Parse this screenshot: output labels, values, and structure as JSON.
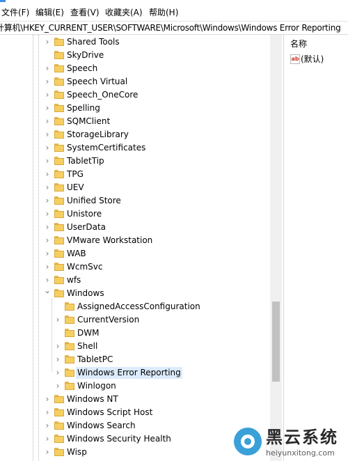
{
  "menubar": {
    "items": [
      "文件(F)",
      "编辑(E)",
      "查看(V)",
      "收藏夹(A)",
      "帮助(H)"
    ]
  },
  "address": {
    "path": "计算机\\HKEY_CURRENT_USER\\SOFTWARE\\Microsoft\\Windows\\Windows Error Reporting"
  },
  "tree": {
    "items": [
      {
        "label": "Shared Tools",
        "level": 1,
        "expander": "collapsed"
      },
      {
        "label": "SkyDrive",
        "level": 1,
        "expander": "none"
      },
      {
        "label": "Speech",
        "level": 1,
        "expander": "collapsed"
      },
      {
        "label": "Speech Virtual",
        "level": 1,
        "expander": "collapsed"
      },
      {
        "label": "Speech_OneCore",
        "level": 1,
        "expander": "collapsed"
      },
      {
        "label": "Spelling",
        "level": 1,
        "expander": "collapsed"
      },
      {
        "label": "SQMClient",
        "level": 1,
        "expander": "collapsed"
      },
      {
        "label": "StorageLibrary",
        "level": 1,
        "expander": "collapsed"
      },
      {
        "label": "SystemCertificates",
        "level": 1,
        "expander": "collapsed"
      },
      {
        "label": "TabletTip",
        "level": 1,
        "expander": "collapsed"
      },
      {
        "label": "TPG",
        "level": 1,
        "expander": "collapsed"
      },
      {
        "label": "UEV",
        "level": 1,
        "expander": "collapsed"
      },
      {
        "label": "Unified Store",
        "level": 1,
        "expander": "collapsed"
      },
      {
        "label": "Unistore",
        "level": 1,
        "expander": "collapsed"
      },
      {
        "label": "UserData",
        "level": 1,
        "expander": "collapsed"
      },
      {
        "label": "VMware Workstation",
        "level": 1,
        "expander": "collapsed"
      },
      {
        "label": "WAB",
        "level": 1,
        "expander": "collapsed"
      },
      {
        "label": "WcmSvc",
        "level": 1,
        "expander": "collapsed"
      },
      {
        "label": "wfs",
        "level": 1,
        "expander": "collapsed"
      },
      {
        "label": "Windows",
        "level": 1,
        "expander": "expanded"
      },
      {
        "label": "AssignedAccessConfiguration",
        "level": 2,
        "expander": "none"
      },
      {
        "label": "CurrentVersion",
        "level": 2,
        "expander": "collapsed"
      },
      {
        "label": "DWM",
        "level": 2,
        "expander": "none"
      },
      {
        "label": "Shell",
        "level": 2,
        "expander": "collapsed"
      },
      {
        "label": "TabletPC",
        "level": 2,
        "expander": "collapsed"
      },
      {
        "label": "Windows Error Reporting",
        "level": 2,
        "expander": "collapsed",
        "selected": true
      },
      {
        "label": "Winlogon",
        "level": 2,
        "expander": "collapsed"
      },
      {
        "label": "Windows NT",
        "level": 1,
        "expander": "collapsed"
      },
      {
        "label": "Windows Script Host",
        "level": 1,
        "expander": "collapsed"
      },
      {
        "label": "Windows Search",
        "level": 1,
        "expander": "collapsed"
      },
      {
        "label": "Windows Security Health",
        "level": 1,
        "expander": "collapsed"
      },
      {
        "label": "Wisp",
        "level": 1,
        "expander": "collapsed"
      }
    ]
  },
  "right_pane": {
    "column_header": "名称",
    "values": [
      {
        "icon": "string-value-icon",
        "icon_text": "ab",
        "name": "(默认)"
      }
    ]
  },
  "watermark": {
    "title": "黑云系统",
    "url": "heiyunxitong.com"
  },
  "colors": {
    "folder": "#f6cf62",
    "selection": "#dcebfb",
    "watermark_blue": "#3aa0d8"
  }
}
